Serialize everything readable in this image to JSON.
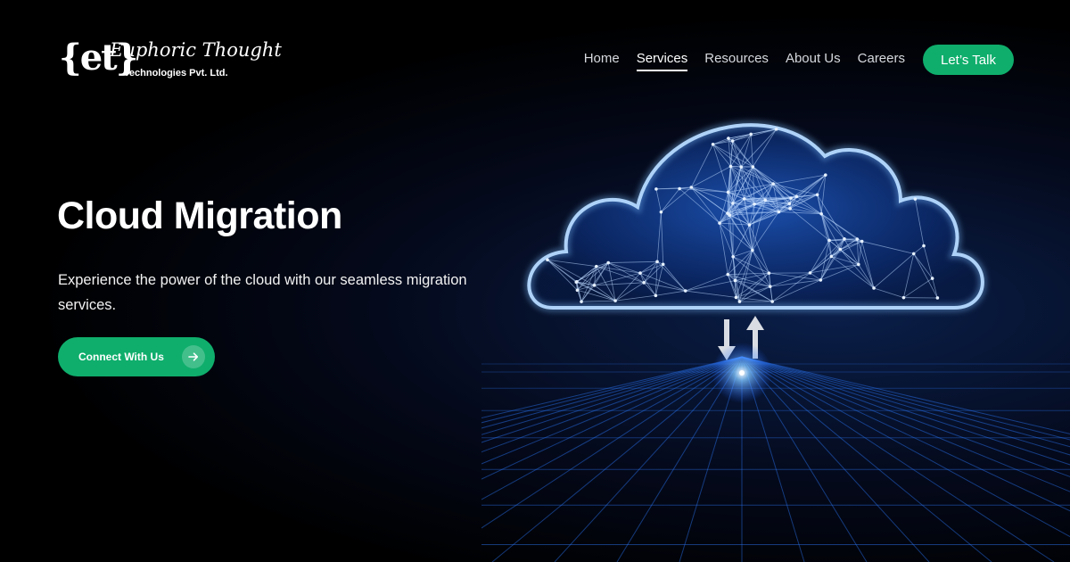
{
  "brand": {
    "mark": "{et}",
    "name": "Euphoric Thought",
    "tagline": "Technologies Pvt. Ltd."
  },
  "nav": {
    "items": [
      {
        "label": "Home",
        "active": false
      },
      {
        "label": "Services",
        "active": true
      },
      {
        "label": "Resources",
        "active": false
      },
      {
        "label": "About Us",
        "active": false
      },
      {
        "label": "Careers",
        "active": false
      }
    ],
    "cta_label": "Let’s Talk"
  },
  "hero": {
    "title": "Cloud Migration",
    "subtitle": "Experience the power of the cloud with our seamless migration services.",
    "cta_label": "Connect With Us",
    "cta_icon": "arrow-right-icon",
    "art_icons": [
      "cloud-network-icon",
      "arrow-down-icon",
      "arrow-up-icon"
    ]
  },
  "colors": {
    "accent": "#0fae6c",
    "background": "#000000",
    "glow": "#3fa9ff"
  }
}
